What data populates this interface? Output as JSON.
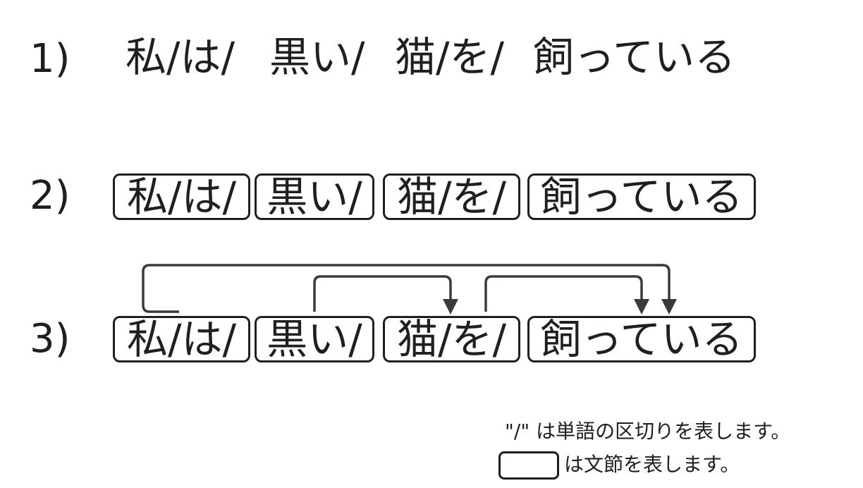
{
  "rows": [
    {
      "label": "1)",
      "segments": [
        "私/は/",
        "黒い/",
        "猫/を/",
        "飼っている"
      ]
    },
    {
      "label": "2)",
      "segments": [
        "私/は/",
        "黒い/",
        "猫/を/",
        "飼っている"
      ]
    },
    {
      "label": "3)",
      "segments": [
        "私/は/",
        "黒い/",
        "猫/を/",
        "飼っている"
      ]
    }
  ],
  "dependencies": [
    {
      "from": "私/は/",
      "to": "飼っている"
    },
    {
      "from": "黒い/",
      "to": "猫/を/"
    },
    {
      "from": "猫/を/",
      "to": "飼っている"
    }
  ],
  "legend": {
    "word_separator": "\"/\" は単語の区切りを表します。",
    "bunsetsu": "は文節を表します。"
  },
  "colors": {
    "stroke": "#1f1f1f",
    "arrow": "#3a3a3a"
  }
}
